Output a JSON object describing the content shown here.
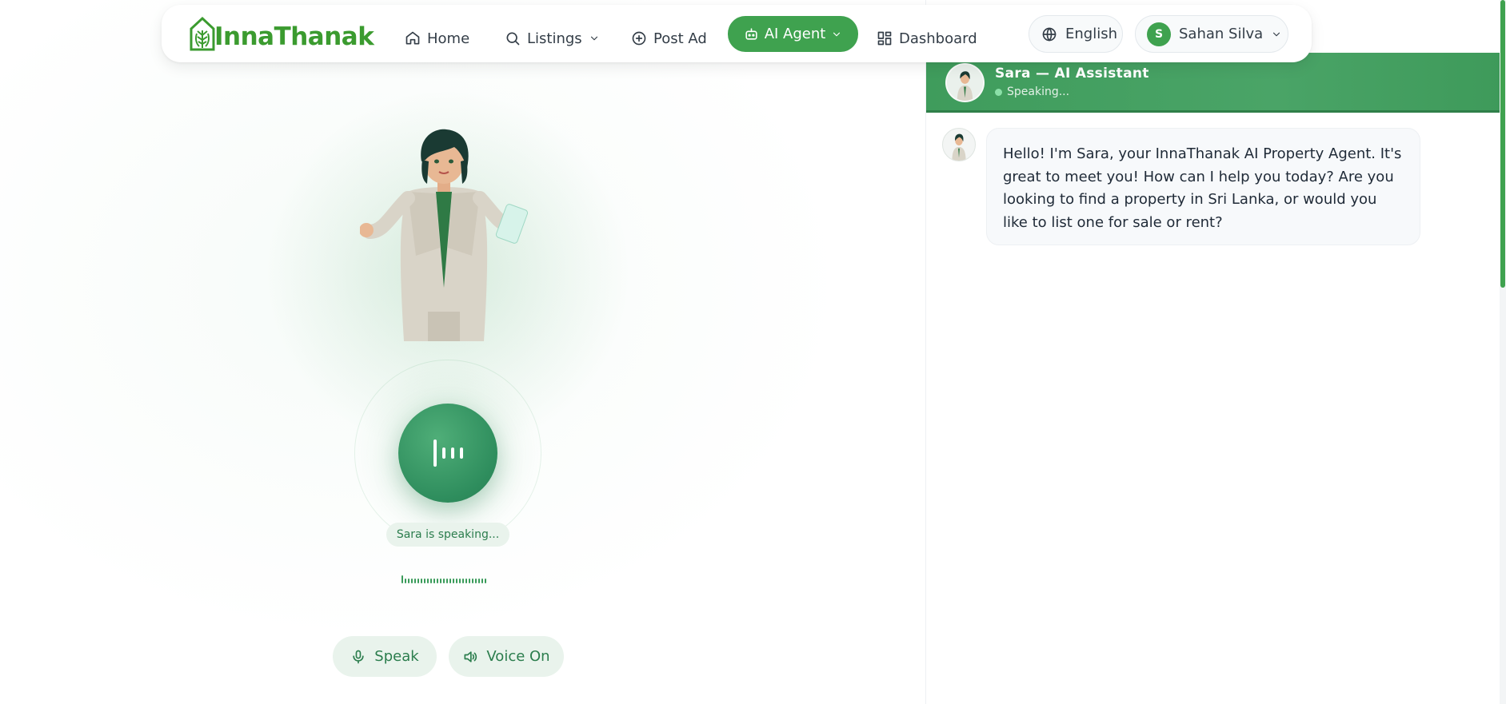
{
  "brand": {
    "name": "InnaThanak",
    "color": "#3b9b2f"
  },
  "nav": {
    "home": "Home",
    "listings": "Listings",
    "post_ad": "Post Ad",
    "ai_agent": "AI Agent",
    "dashboard": "Dashboard",
    "language": "English",
    "user_initial": "S",
    "user_name": "Sahan Silva"
  },
  "icons": {
    "home": "home-icon",
    "listings": "search-icon",
    "post_ad": "plus-circle-icon",
    "ai_agent": "robot-icon",
    "dashboard": "grid-icon",
    "language": "globe-icon",
    "speak": "microphone-icon",
    "voice": "speaker-icon"
  },
  "agent": {
    "status": "Sara is speaking...",
    "speak_label": "Speak",
    "voice_label": "Voice On"
  },
  "chat": {
    "title": "Sara — AI Assistant",
    "subtitle": "Speaking...",
    "messages": [
      {
        "sender": "Sara",
        "text": "Hello! I'm Sara, your InnaThanak AI Property Agent. It's great to meet you! How can I help you today? Are you looking to find a property in Sri Lanka, or would you like to list one for sale or rent?"
      }
    ]
  },
  "colors": {
    "accent": "#3fa24f",
    "chip_bg": "#e9f3ec",
    "chip_text": "#2b7d4d"
  }
}
